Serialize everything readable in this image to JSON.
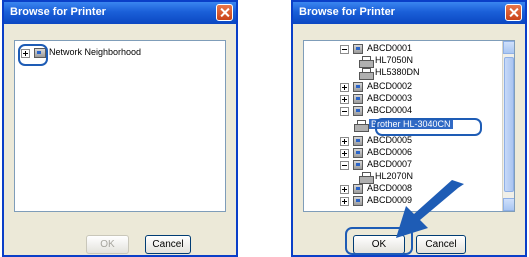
{
  "left_dialog": {
    "title": "Browse for Printer",
    "tree": [
      {
        "label": "Network Neighborhood",
        "expander": "+"
      }
    ],
    "ok_label": "OK",
    "cancel_label": "Cancel"
  },
  "right_dialog": {
    "title": "Browse for Printer",
    "tree": [
      {
        "label": "ABCD0001",
        "type": "computer",
        "expander": "-"
      },
      {
        "label": "HL7050N",
        "type": "printer"
      },
      {
        "label": "HL5380DN",
        "type": "printer"
      },
      {
        "label": "ABCD0002",
        "type": "computer",
        "expander": "+"
      },
      {
        "label": "ABCD0003",
        "type": "computer",
        "expander": "+"
      },
      {
        "label": "ABCD0004",
        "type": "computer",
        "expander": "-"
      },
      {
        "label": "Brother HL-3040CN",
        "type": "printer",
        "selected": true
      },
      {
        "label": "ABCD0005",
        "type": "computer",
        "expander": "+"
      },
      {
        "label": "ABCD0006",
        "type": "computer",
        "expander": "+"
      },
      {
        "label": "ABCD0007",
        "type": "computer",
        "expander": "-"
      },
      {
        "label": "HL2070N",
        "type": "printer"
      },
      {
        "label": "ABCD0008",
        "type": "computer",
        "expander": "+"
      },
      {
        "label": "ABCD0009",
        "type": "computer",
        "expander": "+"
      }
    ],
    "ok_label": "OK",
    "cancel_label": "Cancel"
  },
  "colors": {
    "title_bar": "#0b47c2",
    "callout": "#1e5cb5",
    "selection": "#316ac5"
  }
}
